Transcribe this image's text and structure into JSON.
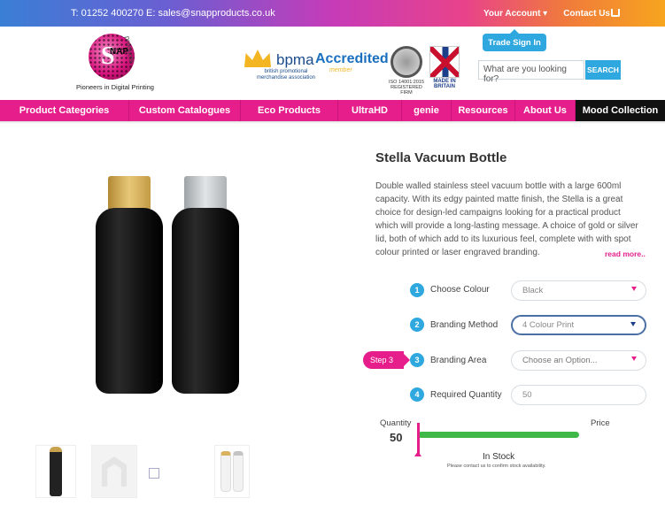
{
  "topbar": {
    "contact": "T: 01252 400270  E: sales@snapproducts.co.uk",
    "account": "Your Account ▾",
    "contact_us": "Contact Us",
    "trade_sign_in": "Trade Sign In"
  },
  "header": {
    "logo_text": "SNAP",
    "logo_s": "S",
    "logo_nap": "NAP",
    "logo_arc": "products",
    "tagline": "Pioneers in Digital Printing",
    "bpma_word": "bpma",
    "bpma_accredited": "Accredited",
    "bpma_member": "member",
    "bpma_sub": "british promotional merchandise association",
    "iso_text": "ISO 14001:2015 REGISTERED FIRM",
    "made_in_britain": "MADE IN BRITAIN",
    "search_placeholder": "What are you looking for?",
    "search_button": "SEARCH"
  },
  "nav": {
    "items": [
      "Product Categories",
      "Custom Catalogues",
      "Eco Products",
      "UltraHD",
      "genie",
      "Resources",
      "About Us",
      "Mood Collection"
    ]
  },
  "product": {
    "title": "Stella Vacuum Bottle",
    "description": "Double walled stainless steel vacuum bottle with a large 600ml capacity. With its edgy painted matte finish, the Stella is a great choice for design-led campaigns looking for a practical product which will provide a long-lasting message. A choice of gold or silver lid, both of which add to its luxurious feel, complete with with spot colour printed or laser engraved branding.",
    "read_more": "read more..",
    "cap_colors": [
      "#d8b25c",
      "#bfc3c6"
    ]
  },
  "steps": [
    {
      "num": "1",
      "label": "Choose Colour",
      "value": "Black"
    },
    {
      "num": "2",
      "label": "Branding Method",
      "value": "4 Colour Print"
    },
    {
      "num": "3",
      "label": "Branding Area",
      "value": "Choose an Option..."
    },
    {
      "num": "4",
      "label": "Required Quantity",
      "value": "50"
    }
  ],
  "step_tag": "Step 3",
  "quantity": {
    "label": "Quantity",
    "value": "50",
    "price_label": "Price",
    "stock": "In Stock",
    "note": "Please contact us to confirm stock availability."
  }
}
